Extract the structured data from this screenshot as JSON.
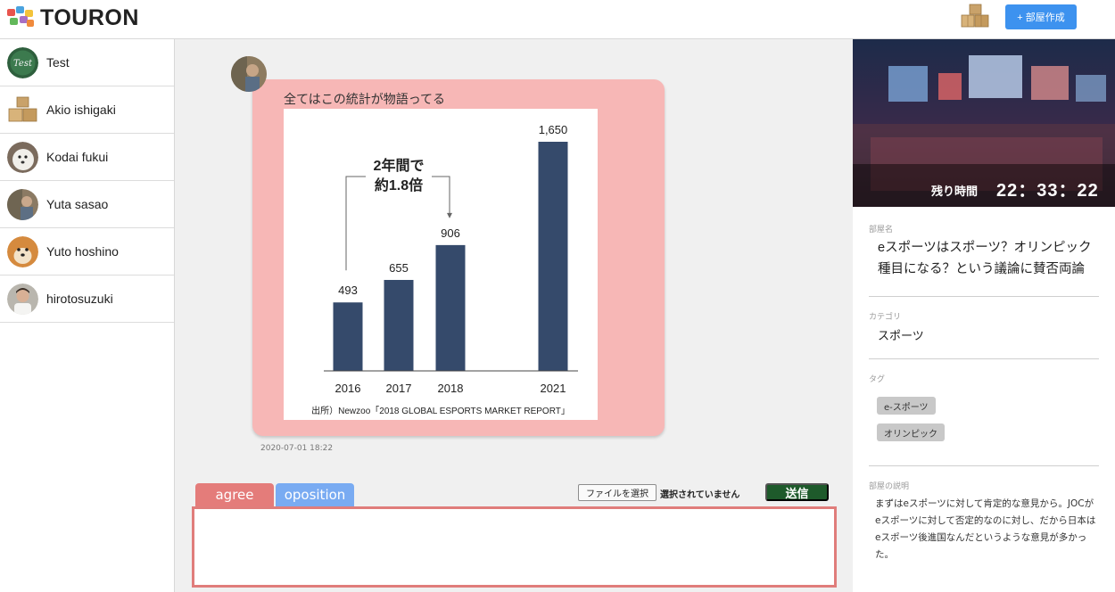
{
  "header": {
    "logo_text": "TOURON",
    "create_button": "+ 部屋作成"
  },
  "sidebar": {
    "users": [
      {
        "name": "Test",
        "avatar": "chalkboard"
      },
      {
        "name": "Akio ishigaki",
        "avatar": "boxes"
      },
      {
        "name": "Kodai fukui",
        "avatar": "dog"
      },
      {
        "name": "Yuta sasao",
        "avatar": "photo"
      },
      {
        "name": "Yuto hoshino",
        "avatar": "shiba"
      },
      {
        "name": "hirotosuzuki",
        "avatar": "person"
      }
    ]
  },
  "message": {
    "text": "全てはこの統計が物語ってる",
    "timestamp": "2020-07-01 18:22"
  },
  "chart_data": {
    "type": "bar",
    "categories": [
      "2016",
      "2017",
      "2018",
      "2021"
    ],
    "values": [
      493,
      655,
      906,
      1650
    ],
    "value_labels": [
      "493",
      "655",
      "906",
      "1,650"
    ],
    "annotation_line1": "2年間で",
    "annotation_line2": "約1.8倍",
    "source": "出所）Newzoo「2018 GLOBAL ESPORTS MARKET REPORT」",
    "bar_color": "#354a6b"
  },
  "composer": {
    "tab_agree": "agree",
    "tab_opposition": "oposition",
    "file_button": "ファイルを選択",
    "file_status": "選択されていません",
    "send_button": "送信",
    "agree_color": "#e47c7a",
    "opposition_color": "#79abf2"
  },
  "room": {
    "timer_label": "残り時間",
    "timer": "22：33：22",
    "name_label": "部屋名",
    "name_line1": "eスポーツはスポーツ？オリンピック",
    "name_line2": "種目になる？という議論に賛否両論",
    "category_label": "カテゴリ",
    "category": "スポーツ",
    "tag_label": "タグ",
    "tags": [
      "e-スポーツ",
      "オリンピック"
    ],
    "description_label": "部屋の説明",
    "description": "まずはeスポーツに対して肯定的な意見から。JOCがeスポーツに対して否定的なのに対し、だから日本はeスポーツ後進国なんだというような意見が多かった。"
  }
}
